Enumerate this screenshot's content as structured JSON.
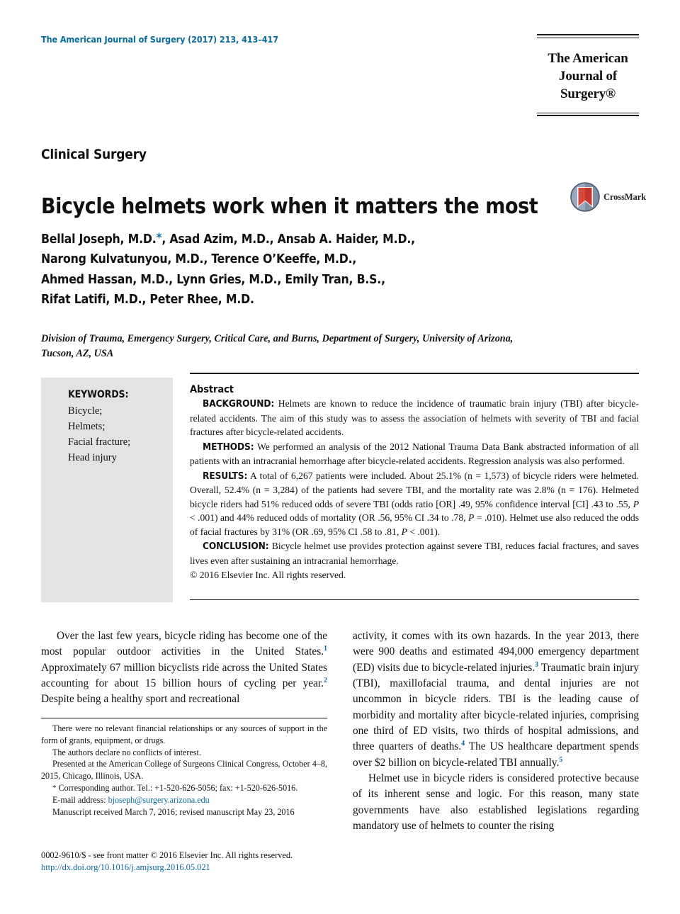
{
  "header": {
    "running_head": "The American Journal of Surgery (2017) 213, 413–417",
    "logo_line1": "The American",
    "logo_line2": "Journal of Surgery®"
  },
  "article": {
    "section_label": "Clinical Surgery",
    "title": "Bicycle helmets work when it matters the most",
    "crossmark_label": "CrossMark",
    "authors_lines": [
      "Bellal Joseph, M.D.*, Asad Azim, M.D., Ansab A. Haider, M.D.,",
      "Narong Kulvatunyou, M.D., Terence O’Keeffe, M.D.,",
      "Ahmed Hassan, M.D., Lynn Gries, M.D., Emily Tran, B.S.,",
      "Rifat Latifi, M.D., Peter Rhee, M.D."
    ],
    "affiliation": "Division of Trauma, Emergency Surgery, Critical Care, and Burns, Department of Surgery, University of Arizona, Tucson, AZ, USA"
  },
  "keywords": {
    "heading": "KEYWORDS:",
    "items": [
      "Bicycle;",
      "Helmets;",
      "Facial fracture;",
      "Head injury"
    ]
  },
  "abstract": {
    "heading": "Abstract",
    "background_label": "BACKGROUND:",
    "background_text": "Helmets are known to reduce the incidence of traumatic brain injury (TBI) after bicycle-related accidents. The aim of this study was to assess the association of helmets with severity of TBI and facial fractures after bicycle-related accidents.",
    "methods_label": "METHODS:",
    "methods_text": "We performed an analysis of the 2012 National Trauma Data Bank abstracted information of all patients with an intracranial hemorrhage after bicycle-related accidents. Regression analysis was also performed.",
    "results_label": "RESULTS:",
    "results_text_1": "A total of 6,267 patients were included. About 25.1% (n = 1,573) of bicycle riders were helmeted. Overall, 52.4% (n = 3,284) of the patients had severe TBI, and the mortality rate was 2.8% (n = 176). Helmeted bicycle riders had 51% reduced odds of severe TBI (odds ratio [OR] .49, 95% confidence interval [CI] .43 to .55, ",
    "results_italic_1": "P",
    "results_text_2": " < .001) and 44% reduced odds of mortality (OR .56, 95% CI .34 to .78, ",
    "results_italic_2": "P",
    "results_text_3": " = .010). Helmet use also reduced the odds of facial fractures by 31% (OR .69, 95% CI .58 to .81, ",
    "results_italic_3": "P",
    "results_text_4": " < .001).",
    "conclusion_label": "CONCLUSION:",
    "conclusion_text": "Bicycle helmet use provides protection against severe TBI, reduces facial fractures, and saves lives even after sustaining an intracranial hemorrhage.",
    "copyright": "© 2016 Elsevier Inc. All rights reserved."
  },
  "body": {
    "left_p1_a": "Over the last few years, bicycle riding has become one of the most popular outdoor activities in the United States.",
    "left_p1_ref1": "1",
    "left_p1_b": " Approximately 67 million bicyclists ride across the United States accounting for about 15 billion hours of cycling per year.",
    "left_p1_ref2": "2",
    "left_p1_c": " Despite being a healthy sport and recreational",
    "right_p1_a": "activity, it comes with its own hazards. In the year 2013, there were 900 deaths and estimated 494,000 emergency department (ED) visits due to bicycle-related injuries.",
    "right_p1_ref3": "3",
    "right_p1_b": " Traumatic brain injury (TBI), maxillofacial trauma, and dental injuries are not uncommon in bicycle riders. TBI is the leading cause of morbidity and mortality after bicycle-related injuries, comprising one third of ED visits, two thirds of hospital admissions, and three quarters of deaths.",
    "right_p1_ref4": "4",
    "right_p1_c": " The US healthcare department spends over $2 billion on bicycle-related TBI annually.",
    "right_p1_ref5": "5",
    "right_p2": "Helmet use in bicycle riders is considered protective because of its inherent sense and logic. For this reason, many state governments have also established legislations regarding mandatory use of helmets to counter the rising"
  },
  "footnotes": {
    "fn1": "There were no relevant financial relationships or any sources of support in the form of grants, equipment, or drugs.",
    "fn2": "The authors declare no conflicts of interest.",
    "fn3": "Presented at the American College of Surgeons Clinical Congress, October 4–8, 2015, Chicago, Illinois, USA.",
    "fn4_star": "*",
    "fn4": " Corresponding author. Tel.: +1-520-626-5056; fax: +1-520-626-5016.",
    "fn5_label": "E-mail address: ",
    "fn5_email": "bjoseph@surgery.arizona.edu",
    "fn6": "Manuscript received March 7, 2016; revised manuscript May 23, 2016"
  },
  "footer": {
    "issn_line": "0002-9610/$ - see front matter © 2016 Elsevier Inc. All rights reserved.",
    "doi_line": "http://dx.doi.org/10.1016/j.amjsurg.2016.05.021"
  },
  "colors": {
    "link_blue": "#0a6a9b",
    "keywords_bg": "#e3e3e3",
    "text_black": "#111111"
  }
}
